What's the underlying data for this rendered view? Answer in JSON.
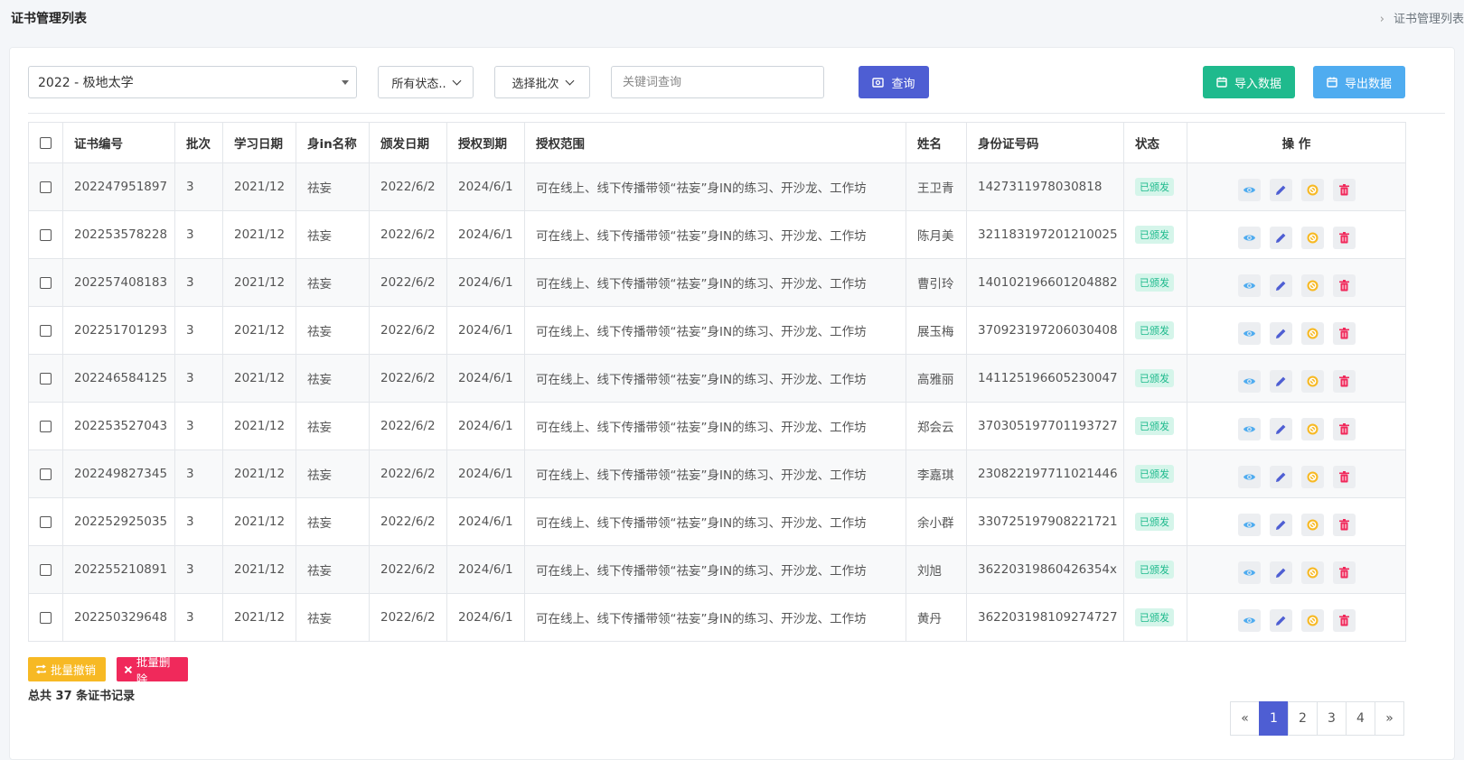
{
  "header": {
    "title": "证书管理列表",
    "breadcrumb": "证书管理列表"
  },
  "filters": {
    "school": "2022 - 极地太学",
    "status": "所有状态..",
    "batch": "选择批次",
    "keyword_placeholder": "关键词查询",
    "query_label": "查询",
    "import_label": "导入数据",
    "export_label": "导出数据"
  },
  "table": {
    "columns": [
      "证书编号",
      "批次",
      "学习日期",
      "身in名称",
      "颁发日期",
      "授权到期",
      "授权范围",
      "姓名",
      "身份证号码",
      "状态",
      "操 作"
    ],
    "rows": [
      [
        "202247951897",
        "3",
        "2021/12",
        "祛妄",
        "2022/6/2",
        "2024/6/1",
        "可在线上、线下传播带领“祛妄”身IN的练习、开沙龙、工作坊",
        "王卫青",
        "1427311978030818",
        "已颁发"
      ],
      [
        "202253578228",
        "3",
        "2021/12",
        "祛妄",
        "2022/6/2",
        "2024/6/1",
        "可在线上、线下传播带领“祛妄”身IN的练习、开沙龙、工作坊",
        "陈月美",
        "321183197201210025",
        "已颁发"
      ],
      [
        "202257408183",
        "3",
        "2021/12",
        "祛妄",
        "2022/6/2",
        "2024/6/1",
        "可在线上、线下传播带领“祛妄”身IN的练习、开沙龙、工作坊",
        "曹引玲",
        "140102196601204882",
        "已颁发"
      ],
      [
        "202251701293",
        "3",
        "2021/12",
        "祛妄",
        "2022/6/2",
        "2024/6/1",
        "可在线上、线下传播带领“祛妄”身IN的练习、开沙龙、工作坊",
        "展玉梅",
        "370923197206030408",
        "已颁发"
      ],
      [
        "202246584125",
        "3",
        "2021/12",
        "祛妄",
        "2022/6/2",
        "2024/6/1",
        "可在线上、线下传播带领“祛妄”身IN的练习、开沙龙、工作坊",
        "高雅丽",
        "141125196605230047",
        "已颁发"
      ],
      [
        "202253527043",
        "3",
        "2021/12",
        "祛妄",
        "2022/6/2",
        "2024/6/1",
        "可在线上、线下传播带领“祛妄”身IN的练习、开沙龙、工作坊",
        "郑会云",
        "370305197701193727",
        "已颁发"
      ],
      [
        "202249827345",
        "3",
        "2021/12",
        "祛妄",
        "2022/6/2",
        "2024/6/1",
        "可在线上、线下传播带领“祛妄”身IN的练习、开沙龙、工作坊",
        "李嘉琪",
        "230822197711021446",
        "已颁发"
      ],
      [
        "202252925035",
        "3",
        "2021/12",
        "祛妄",
        "2022/6/2",
        "2024/6/1",
        "可在线上、线下传播带领“祛妄”身IN的练习、开沙龙、工作坊",
        "余小群",
        "330725197908221721",
        "已颁发"
      ],
      [
        "202255210891",
        "3",
        "2021/12",
        "祛妄",
        "2022/6/2",
        "2024/6/1",
        "可在线上、线下传播带领“祛妄”身IN的练习、开沙龙、工作坊",
        "刘旭",
        "36220319860426354x",
        "已颁发"
      ],
      [
        "202250329648",
        "3",
        "2021/12",
        "祛妄",
        "2022/6/2",
        "2024/6/1",
        "可在线上、线下传播带领“祛妄”身IN的练习、开沙龙、工作坊",
        "黄丹",
        "362203198109274727",
        "已颁发"
      ]
    ],
    "row_actions": [
      "eye-icon",
      "pencil-icon",
      "revoke-icon",
      "trash-icon"
    ]
  },
  "bulk": {
    "revoke_label": "批量撤销",
    "delete_label": "批量删除"
  },
  "summary": {
    "total_text": "总共 37 条证书记录"
  },
  "pagination": {
    "prev": "«",
    "pages": [
      "1",
      "2",
      "3",
      "4"
    ],
    "next": "»",
    "current": "1"
  },
  "colors": {
    "primary": "#4e5ed3",
    "success": "#1fba8d",
    "info": "#4facf0",
    "warning": "#f7b924",
    "danger": "#f0295b"
  }
}
